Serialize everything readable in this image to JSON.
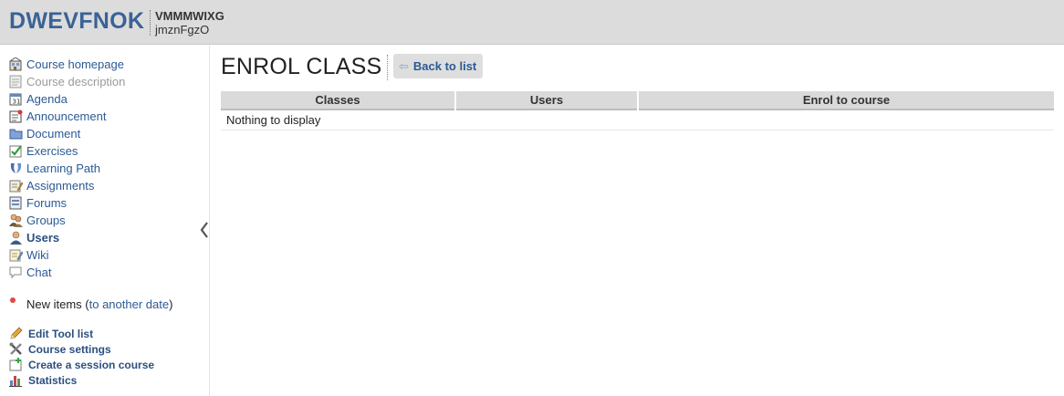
{
  "header": {
    "site_title": "DWEVFNOK",
    "course_code": "VMMMWIXG",
    "course_subtitle": "jmznFgzO"
  },
  "sidebar": {
    "tools": [
      {
        "label": "Course homepage",
        "icon": "home-icon",
        "state": "normal"
      },
      {
        "label": "Course description",
        "icon": "description-icon",
        "state": "disabled"
      },
      {
        "label": "Agenda",
        "icon": "calendar-icon",
        "state": "normal"
      },
      {
        "label": "Announcement",
        "icon": "announcement-icon",
        "state": "normal"
      },
      {
        "label": "Document",
        "icon": "folder-icon",
        "state": "normal"
      },
      {
        "label": "Exercises",
        "icon": "checkmark-icon",
        "state": "normal"
      },
      {
        "label": "Learning Path",
        "icon": "learning-path-icon",
        "state": "normal"
      },
      {
        "label": "Assignments",
        "icon": "assignment-icon",
        "state": "normal"
      },
      {
        "label": "Forums",
        "icon": "forum-icon",
        "state": "normal"
      },
      {
        "label": "Groups",
        "icon": "groups-icon",
        "state": "normal"
      },
      {
        "label": "Users",
        "icon": "user-icon",
        "state": "active"
      },
      {
        "label": "Wiki",
        "icon": "wiki-icon",
        "state": "normal"
      },
      {
        "label": "Chat",
        "icon": "chat-icon",
        "state": "normal"
      }
    ],
    "new_items": {
      "prefix": "New items (",
      "link": "to another date",
      "suffix": ")"
    },
    "admin": [
      {
        "label": "Edit Tool list",
        "icon": "pencil-icon"
      },
      {
        "label": "Course settings",
        "icon": "tools-icon"
      },
      {
        "label": "Create a session course",
        "icon": "create-session-icon"
      },
      {
        "label": "Statistics",
        "icon": "statistics-icon"
      }
    ]
  },
  "main": {
    "title": "ENROL CLASS",
    "back_label": "Back to list",
    "back_arrow": "⇦",
    "table": {
      "columns": [
        "Classes",
        "Users",
        "Enrol to course"
      ],
      "empty_message": "Nothing to display"
    }
  },
  "colors": {
    "header_bg": "#dcdcdc",
    "brand_blue": "#3a6296",
    "link_blue": "#2b5a95",
    "table_header_bg": "#dadada"
  }
}
